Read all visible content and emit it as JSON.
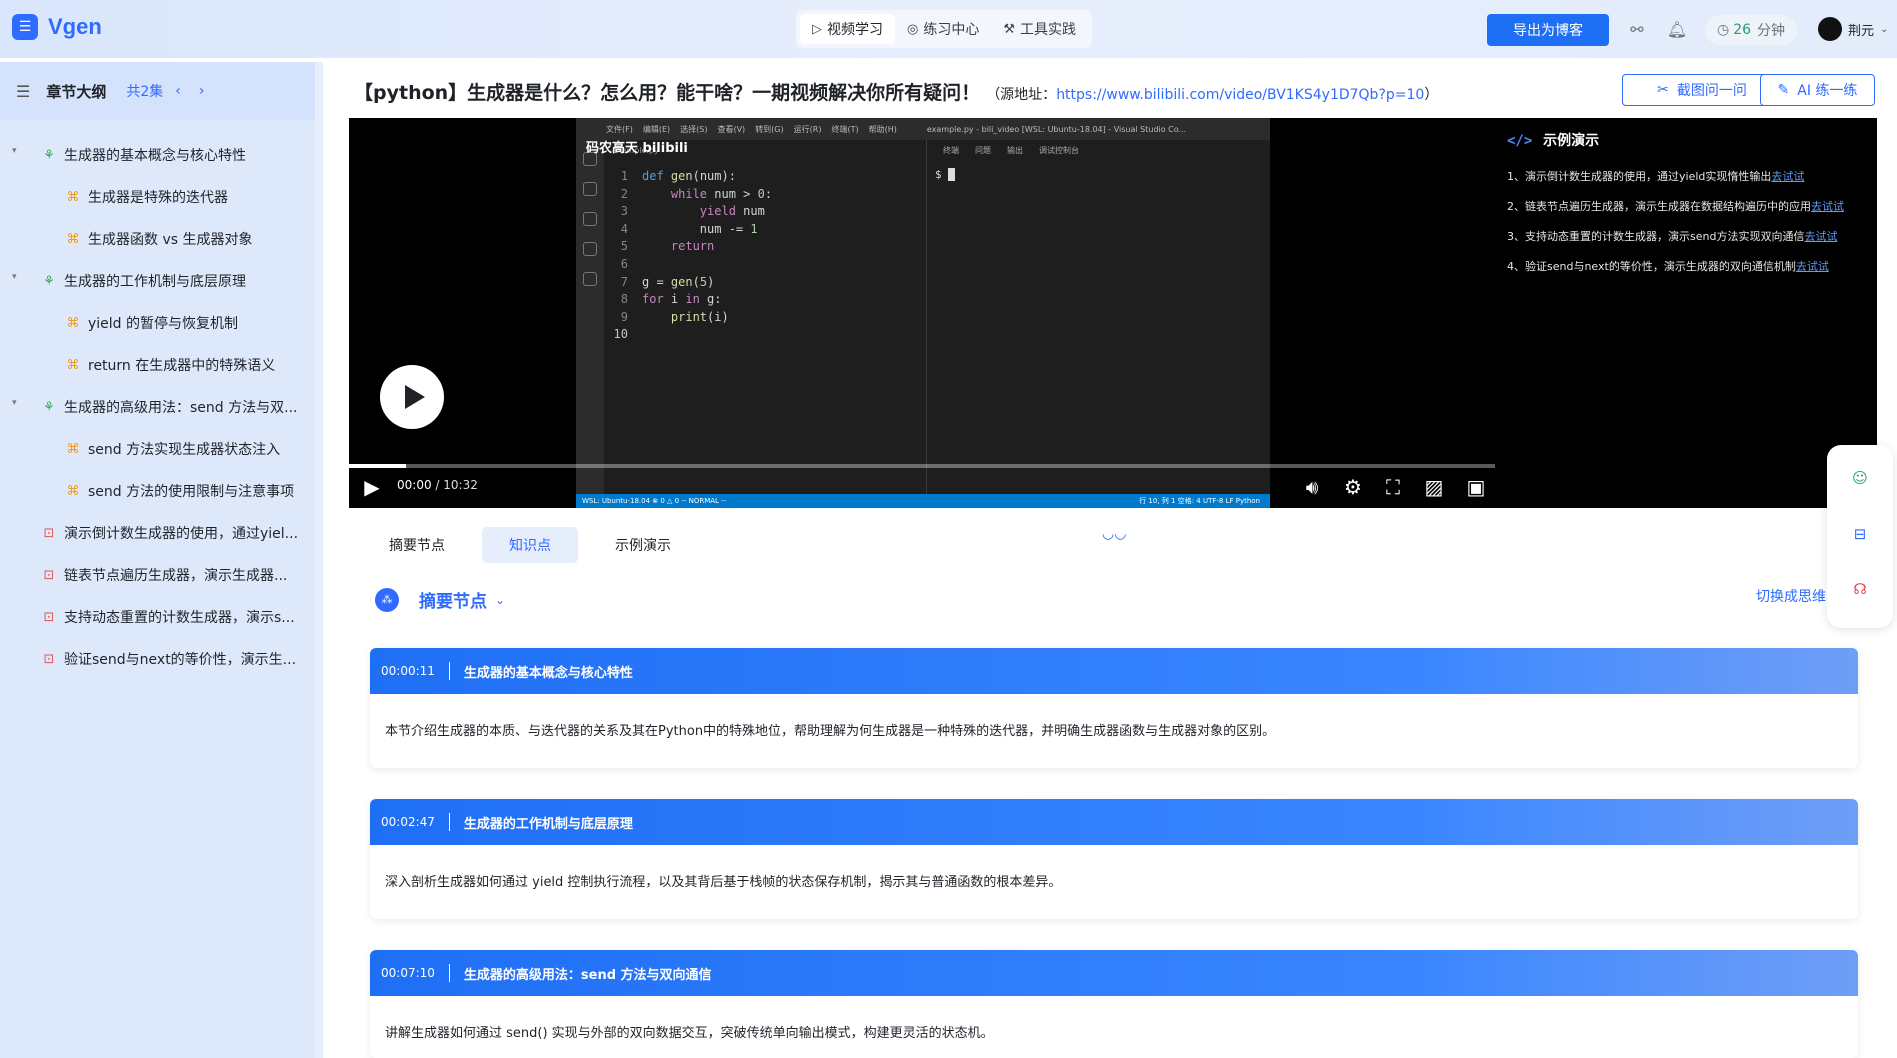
{
  "app": {
    "logo_text": "Vgen",
    "logo_icon": "list-icon"
  },
  "topnav": [
    {
      "label": "视频学习",
      "icon": "play-outline-icon",
      "active": true
    },
    {
      "label": "练习中心",
      "icon": "target-icon",
      "active": false
    },
    {
      "label": "工具实践",
      "icon": "wrench-icon",
      "active": false
    }
  ],
  "header": {
    "export_label": "导出为博客",
    "timer_value": "26",
    "timer_unit": "分钟",
    "user_name": "荆元"
  },
  "sidebar": {
    "title": "章节大纲",
    "count": "共2集",
    "items": [
      {
        "label": "生成器的基本概念与核心特性",
        "level": 1,
        "icon": "tree-icon"
      },
      {
        "label": "生成器是特殊的迭代器",
        "level": 2,
        "icon": "node-icon"
      },
      {
        "label": "生成器函数 vs 生成器对象",
        "level": 2,
        "icon": "node-icon"
      },
      {
        "label": "生成器的工作机制与底层原理",
        "level": 1,
        "icon": "tree-icon"
      },
      {
        "label": "yield 的暂停与恢复机制",
        "level": 2,
        "icon": "node-icon"
      },
      {
        "label": "return 在生成器中的特殊语义",
        "level": 2,
        "icon": "node-icon"
      },
      {
        "label": "生成器的高级用法：send 方法与双...",
        "level": 1,
        "icon": "tree-icon"
      },
      {
        "label": "send 方法实现生成器状态注入",
        "level": 2,
        "icon": "node-icon"
      },
      {
        "label": "send 方法的使用限制与注意事项",
        "level": 2,
        "icon": "node-icon"
      },
      {
        "label": "演示倒计数生成器的使用，通过yiel...",
        "level": 0,
        "icon": "demo-icon"
      },
      {
        "label": "链表节点遍历生成器，演示生成器...",
        "level": 0,
        "icon": "demo-icon"
      },
      {
        "label": "支持动态重置的计数生成器，演示s...",
        "level": 0,
        "icon": "demo-icon"
      },
      {
        "label": "验证send与next的等价性，演示生...",
        "level": 0,
        "icon": "demo-icon"
      }
    ]
  },
  "main": {
    "title": "【python】生成器是什么？怎么用？能干啥？一期视频解决你所有疑问！",
    "source_prefix": "（源地址：",
    "source_url": "https://www.bilibili.com/video/BV1KS4y1D7Qb?p=10",
    "source_suffix": "）",
    "screenshot_btn": "截图问一问",
    "ai_btn": "AI 练一练"
  },
  "video": {
    "watermark": "码农高天 bilibili",
    "vscode_title": "example.py - bili_video [WSL: Ubuntu-18.04] - Visual Studio Co...",
    "vscode_menus": [
      "文件(F)",
      "编辑(E)",
      "选择(S)",
      "查看(V)",
      "转到(G)",
      "运行(R)",
      "终端(T)",
      "帮助(H)"
    ],
    "file_tab": "example.py",
    "terminal_tabs": [
      "终端",
      "问题",
      "输出",
      "调试控制台"
    ],
    "terminal_prompt": "$",
    "code_lines": [
      "def gen(num):",
      "    while num > 0:",
      "        yield num",
      "        num -= 1",
      "    return",
      "",
      "g = gen(5)",
      "for i in g:",
      "    print(i)",
      ""
    ],
    "status_left": "WSL: Ubuntu-18.04   ⊗ 0 △ 0   -- NORMAL --",
    "status_right": "行 10, 列 1   空格: 4   UTF-8   LF   Python",
    "current_time": "00:00",
    "total_time": "10:32",
    "progress": 0.05
  },
  "demo_panel": {
    "title": "示例演示",
    "tag": "</>",
    "try_label": "去试试",
    "items": [
      "1、演示倒计数生成器的使用，通过yield实现惰性输出",
      "2、链表节点遍历生成器，演示生成器在数据结构遍历中的应用",
      "3、支持动态重置的计数生成器，演示send方法实现双向通信",
      "4、验证send与next的等价性，演示生成器的双向通信机制"
    ]
  },
  "tabs": [
    {
      "label": "摘要节点",
      "active": false
    },
    {
      "label": "知识点",
      "active": true
    },
    {
      "label": "示例演示",
      "active": false
    }
  ],
  "summary": {
    "title": "摘要节点",
    "switch_label": "切换成思维"
  },
  "cards": [
    {
      "time": "00:00:11",
      "title": "生成器的基本概念与核心特性",
      "body": "本节介绍生成器的本质、与迭代器的关系及其在Python中的特殊地位，帮助理解为何生成器是一种特殊的迭代器，并明确生成器函数与生成器对象的区别。"
    },
    {
      "time": "00:02:47",
      "title": "生成器的工作机制与底层原理",
      "body": "深入剖析生成器如何通过 yield 控制执行流程，以及其背后基于栈帧的状态保存机制，揭示其与普通函数的根本差异。"
    },
    {
      "time": "00:07:10",
      "title": "生成器的高级用法：send 方法与双向通信",
      "body": "讲解生成器如何通过 send() 实现与外部的双向数据交互，突破传统单向输出模式，构建更灵活的状态机。"
    }
  ],
  "colors": {
    "accent": "#2f6bff",
    "sidebar_bg": "#dde8fb",
    "card_head": "#1f6ff5"
  }
}
